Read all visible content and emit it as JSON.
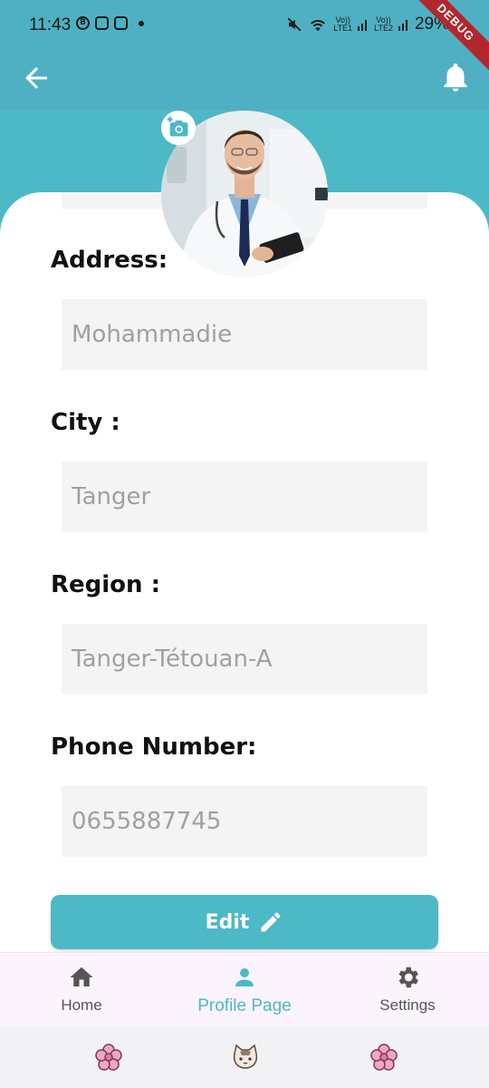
{
  "status_bar": {
    "time": "11:43",
    "battery": "29%",
    "signal_1": "Vo))\nLTE1",
    "signal_2": "Vo))\nLTE2"
  },
  "debug_banner": "DEBUG",
  "colors": {
    "primary": "#4db8c6",
    "app_bar": "#4fb0c3",
    "field_bg": "#f4f4f4",
    "nav_bg": "#fcf4fc"
  },
  "form": {
    "address": {
      "label": "Address:",
      "value": "Mohammadie"
    },
    "city": {
      "label": "City :",
      "value": "Tanger"
    },
    "region": {
      "label": "Region :",
      "value": "Tanger-Tétouan-A"
    },
    "phone": {
      "label": "Phone Number:",
      "value": "0655887745"
    }
  },
  "edit_button": {
    "label": "Edit"
  },
  "bottom_nav": [
    {
      "label": "Home",
      "icon": "home-icon",
      "active": false
    },
    {
      "label": "Profile Page",
      "icon": "person-icon",
      "active": true
    },
    {
      "label": "Settings",
      "icon": "gear-icon",
      "active": false
    }
  ],
  "system_nav": [
    "flower-icon",
    "cat-icon",
    "flower-icon"
  ]
}
